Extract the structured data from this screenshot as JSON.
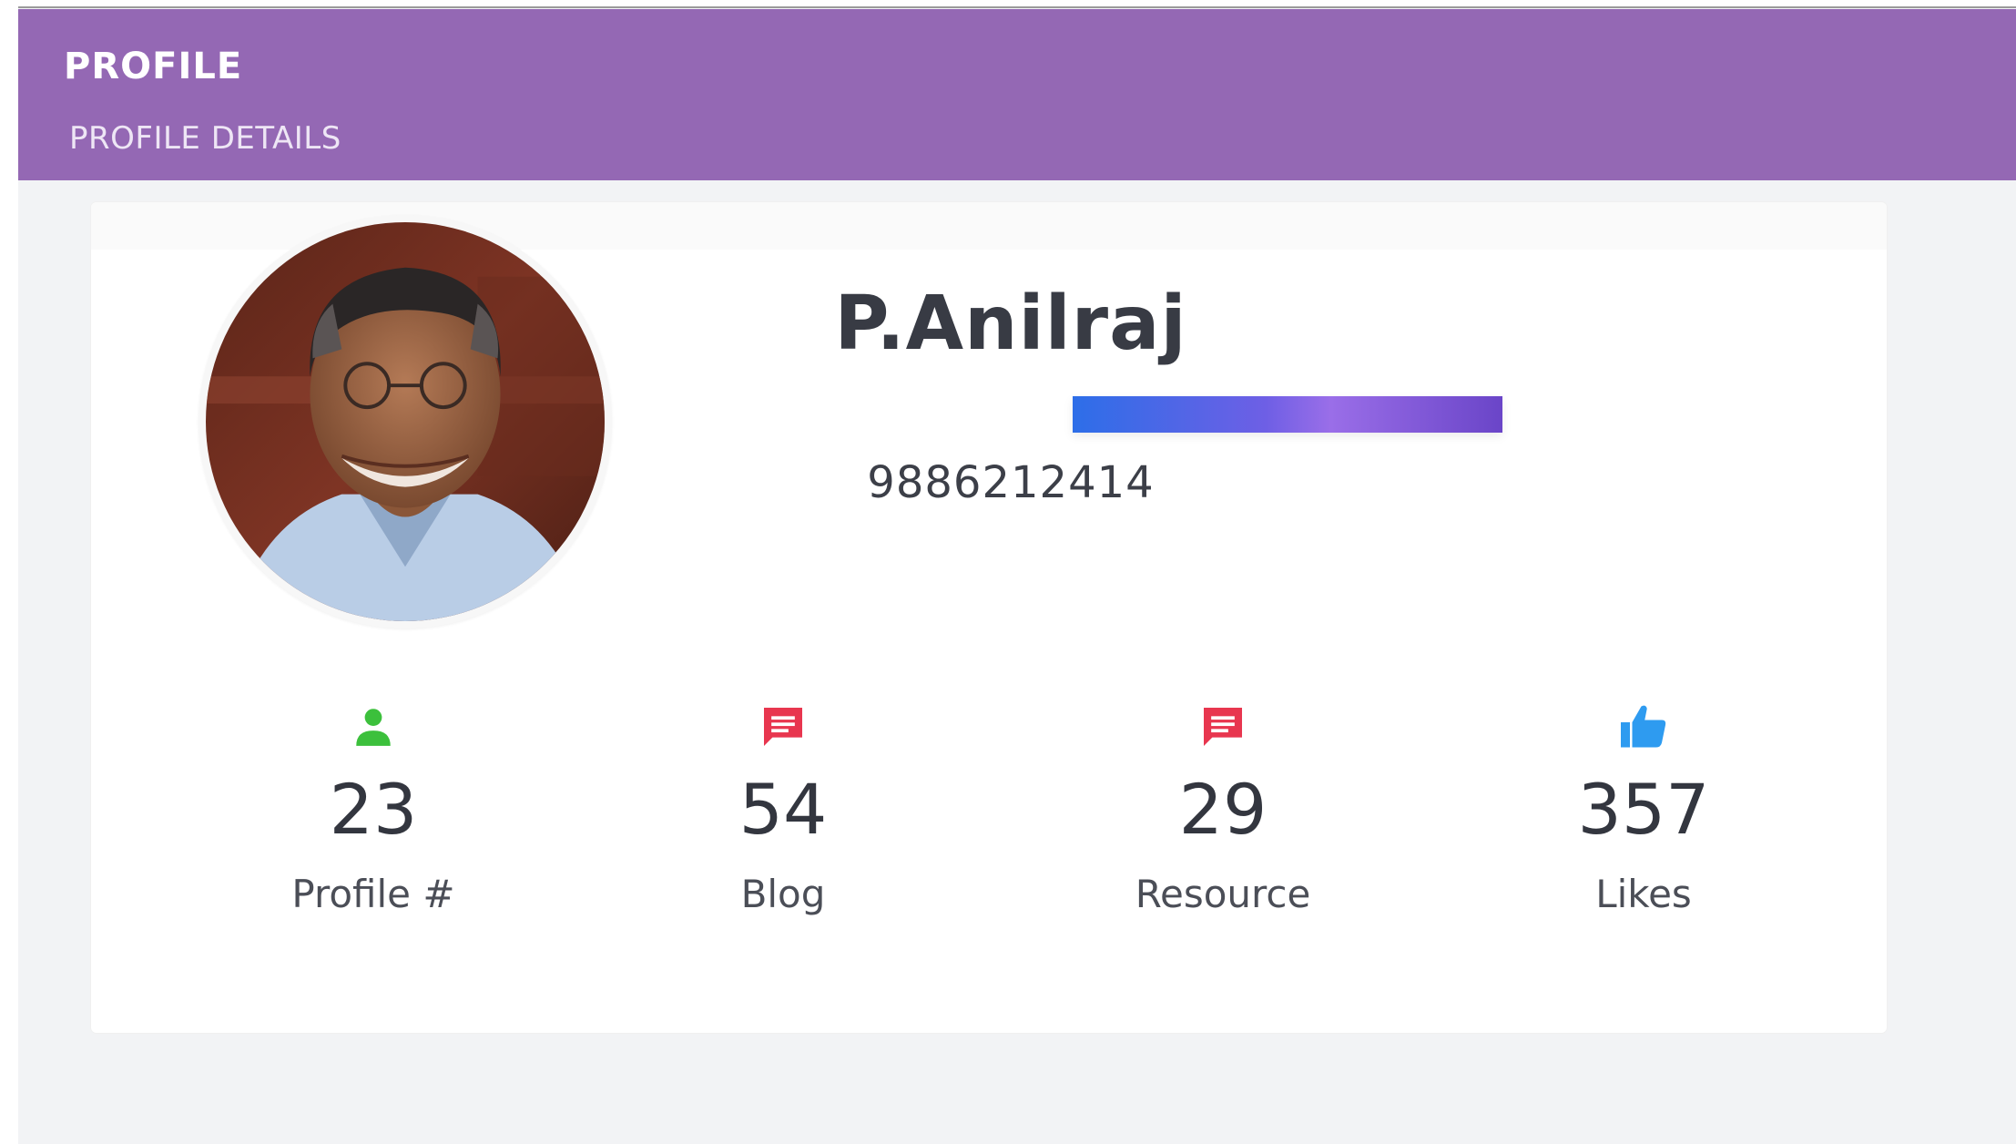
{
  "header": {
    "title": "PROFILE",
    "subtitle": "PROFILE DETAILS",
    "color": "#9468b4"
  },
  "profile": {
    "name": "P.Anilraj",
    "phone": "9886212414",
    "avatar_icon": "profile-photo"
  },
  "stats": [
    {
      "value": "23",
      "label": "Profile #",
      "icon": "person-icon",
      "color": "#3cc03c"
    },
    {
      "value": "54",
      "label": "Blog",
      "icon": "message-icon",
      "color": "#e8364f"
    },
    {
      "value": "29",
      "label": "Resource",
      "icon": "message-icon",
      "color": "#e8364f"
    },
    {
      "value": "357",
      "label": "Likes",
      "icon": "thumbs-up-icon",
      "color": "#2e9bf0"
    }
  ]
}
